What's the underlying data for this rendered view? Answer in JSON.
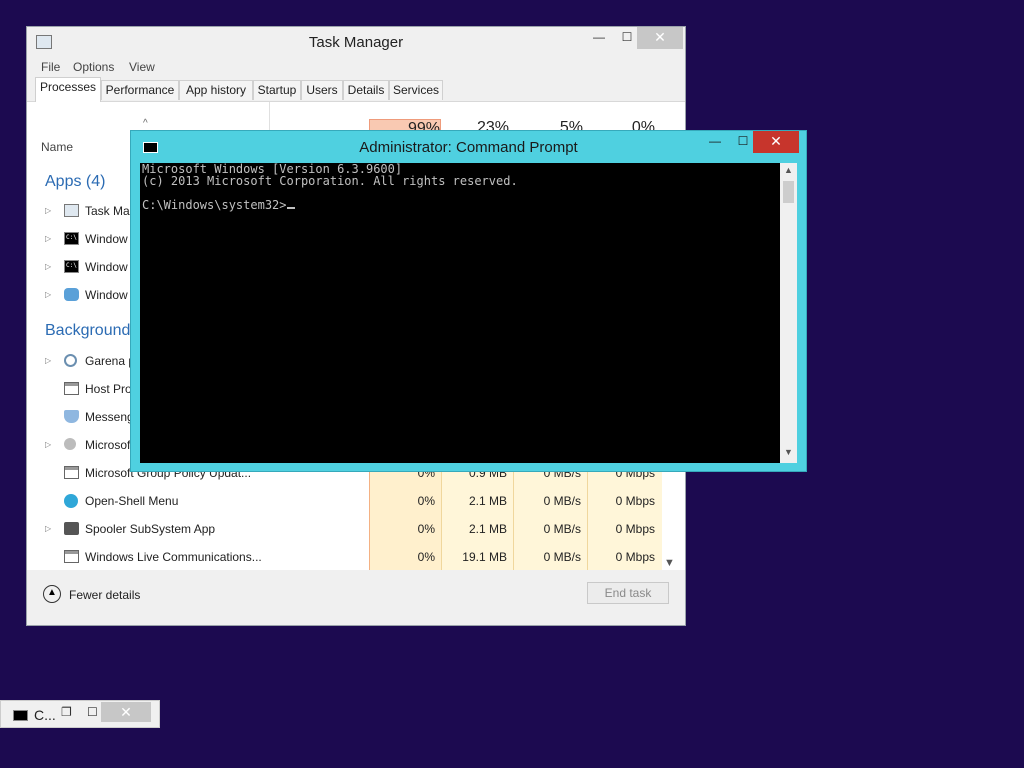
{
  "task_manager": {
    "title": "Task Manager",
    "controls": {
      "minimize": "—",
      "maximize": "☐",
      "close": "✕"
    },
    "menu": [
      "File",
      "Options",
      "View"
    ],
    "tabs": [
      "Processes",
      "Performance",
      "App history",
      "Startup",
      "Users",
      "Details",
      "Services"
    ],
    "active_tab": "Processes",
    "columns": {
      "name": "Name",
      "cpu": "99%",
      "memory": "23%",
      "disk": "5%",
      "network": "0%"
    },
    "groups": {
      "apps": "Apps (4)",
      "background": "Background"
    },
    "apps": [
      {
        "name": "Task Ma",
        "icon": "task-manager-icon",
        "expandable": true
      },
      {
        "name": "Window",
        "icon": "command-prompt-icon",
        "expandable": true
      },
      {
        "name": "Window",
        "icon": "command-prompt-icon",
        "expandable": true
      },
      {
        "name": "Window",
        "icon": "people-icon",
        "expandable": true
      }
    ],
    "background_processes": [
      {
        "name": "Garena p",
        "icon": "gear-icon",
        "expandable": true
      },
      {
        "name": "Host Pro",
        "icon": "window-icon",
        "expandable": false
      },
      {
        "name": "Messeng",
        "icon": "shield-icon",
        "expandable": false
      },
      {
        "name": "Microsof",
        "icon": "user-icon",
        "expandable": true
      },
      {
        "name": "Microsoft Group Policy Updat...",
        "icon": "window-icon",
        "expandable": false,
        "cpu": "0%",
        "memory": "0.9 MB",
        "disk": "0 MB/s",
        "network": "0 Mbps"
      },
      {
        "name": "Open-Shell Menu",
        "icon": "globe-icon",
        "expandable": false,
        "cpu": "0%",
        "memory": "2.1 MB",
        "disk": "0 MB/s",
        "network": "0 Mbps"
      },
      {
        "name": "Spooler SubSystem App",
        "icon": "printer-icon",
        "expandable": true,
        "cpu": "0%",
        "memory": "2.1 MB",
        "disk": "0 MB/s",
        "network": "0 Mbps"
      },
      {
        "name": "Windows Live Communications...",
        "icon": "window-icon",
        "expandable": false,
        "cpu": "0%",
        "memory": "19.1 MB",
        "disk": "0 MB/s",
        "network": "0 Mbps"
      }
    ],
    "footer": {
      "fewer_details": "Fewer details",
      "end_task": "End task"
    }
  },
  "command_prompt": {
    "title": "Administrator:  Command Prompt",
    "controls": {
      "minimize": "—",
      "maximize": "☐",
      "close": "✕"
    },
    "lines": [
      "Microsoft Windows [Version 6.3.9600]",
      "(c) 2013 Microsoft Corporation. All rights reserved.",
      "",
      "C:\\Windows\\system32>"
    ]
  },
  "minimized_window": {
    "title": "C...",
    "controls": {
      "restore": "❐",
      "maximize": "☐",
      "close": "✕"
    }
  },
  "colors": {
    "desktop": "#1c0a50",
    "cmd_frame": "#4fd0e0",
    "cpu_highlight": "#f9c9b2",
    "column_highlight": "#fff0cd"
  }
}
